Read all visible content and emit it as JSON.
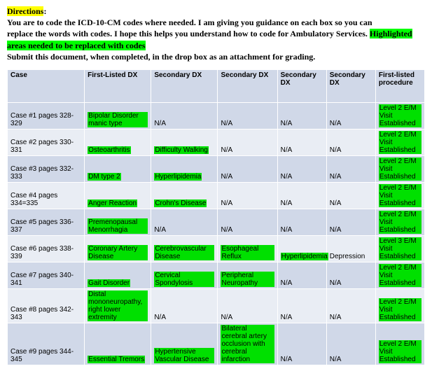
{
  "directions": {
    "label": "Directions",
    "line1a": "You are to code the ICD-10-CM codes where needed.  I am giving you guidance on each box so you can",
    "line2": "replace the words with codes.  I hope this helps you understand how to code for Ambulatory Services.  ",
    "line2_hl": "Highlighted areas needed to be replaced with codes",
    "line3": "Submit this document, when completed, in the drop box as an attachment for grading."
  },
  "headers": {
    "c1": "Case",
    "c2": "First-Listed DX",
    "c3": "Secondary DX",
    "c4": "Secondary DX",
    "c5": "Secondary DX",
    "c6": "Secondary DX",
    "c7": "First-listed procedure"
  },
  "rows": [
    {
      "case": "Case #1 pages 328-329",
      "dx1": {
        "text": "Bipolar Disorder manic type",
        "hl": true
      },
      "dx2": {
        "text": "N/A",
        "hl": false
      },
      "dx3": {
        "text": "N/A",
        "hl": false
      },
      "dx4": {
        "text": "N/A",
        "hl": false
      },
      "dx5": {
        "text": "N/A",
        "hl": false
      },
      "proc": {
        "text": "Level 2 E/M Visit Established",
        "hl": true
      }
    },
    {
      "case": "Case #2 pages 330-331",
      "dx1": {
        "text": "Osteoarthritis",
        "hl": true
      },
      "dx2": {
        "text": "Difficulty Walking",
        "hl": true
      },
      "dx3": {
        "text": "N/A",
        "hl": false
      },
      "dx4": {
        "text": "N/A",
        "hl": false
      },
      "dx5": {
        "text": "N/A",
        "hl": false
      },
      "proc": {
        "text": "Level 2 E/M Visit Established",
        "hl": true
      }
    },
    {
      "case": "Case #3 pages 332-333",
      "dx1": {
        "text": "DM type 2",
        "hl": true
      },
      "dx2": {
        "text": "Hyperlipidemia",
        "hl": true
      },
      "dx3": {
        "text": "N/A",
        "hl": false
      },
      "dx4": {
        "text": "N/A",
        "hl": false
      },
      "dx5": {
        "text": "N/A",
        "hl": false
      },
      "proc": {
        "text": "Level 2 E/M Visit Established",
        "hl": true
      }
    },
    {
      "case": "Case #4 pages 334=335",
      "dx1": {
        "text": "Anger Reaction",
        "hl": true
      },
      "dx2": {
        "text": "Crohn's Disease",
        "hl": true
      },
      "dx3": {
        "text": "N/A",
        "hl": false
      },
      "dx4": {
        "text": "N/A",
        "hl": false
      },
      "dx5": {
        "text": "N/A",
        "hl": false
      },
      "proc": {
        "text": "Level 2 E/M Visit Established",
        "hl": true
      }
    },
    {
      "case": "Case #5 pages 336-337",
      "dx1": {
        "text": "Premenopausal Menorrhagia",
        "hl": true
      },
      "dx2": {
        "text": "N/A",
        "hl": false
      },
      "dx3": {
        "text": "N/A",
        "hl": false
      },
      "dx4": {
        "text": "N/A",
        "hl": false
      },
      "dx5": {
        "text": "N/A",
        "hl": false
      },
      "proc": {
        "text": "Level 2 E/M Visit Established",
        "hl": true
      }
    },
    {
      "case": "Case #6 pages 338-339",
      "dx1": {
        "text": "Coronary Artery Disease",
        "hl": true
      },
      "dx2": {
        "text": "Cerebrovascular Disease",
        "hl": true
      },
      "dx3": {
        "text": "Esophageal Reflux",
        "hl": true
      },
      "dx4": {
        "text": "Hyperlipidemia",
        "hl": true
      },
      "dx5": {
        "text": "Depression",
        "hl": false
      },
      "proc": {
        "text": "Level 3 E/M Visit Established",
        "hl": true
      }
    },
    {
      "case": "Case #7 pages 340-341",
      "dx1": {
        "text": "Gait Disorder",
        "hl": true
      },
      "dx2": {
        "text": "Cervical Spondylosis",
        "hl": true
      },
      "dx3": {
        "text": "Peripheral Neuropathy",
        "hl": true
      },
      "dx4": {
        "text": "N/A",
        "hl": false
      },
      "dx5": {
        "text": "N/A",
        "hl": false
      },
      "proc": {
        "text": "Level 2 E/M Visit Established",
        "hl": true
      }
    },
    {
      "case": "Case #8 pages 342-343",
      "dx1": {
        "text": "Distal mononeuropathy, right lower extremity",
        "hl": true
      },
      "dx2": {
        "text": "N/A",
        "hl": false
      },
      "dx3": {
        "text": "N/A",
        "hl": false
      },
      "dx4": {
        "text": "N/A",
        "hl": false
      },
      "dx5": {
        "text": "N/A",
        "hl": false
      },
      "proc": {
        "text": "Level 2 E/M Visit Established",
        "hl": true
      }
    },
    {
      "case": "Case #9 pages 344-345",
      "dx1": {
        "text": "Essential Tremors",
        "hl": true
      },
      "dx2": {
        "text": "Hypertensive Vascular Disease",
        "hl": true
      },
      "dx3": {
        "text": "Bilateral cerebral artery occlusion with cerebral infarction",
        "hl": true
      },
      "dx4": {
        "text": "N/A",
        "hl": false
      },
      "dx5": {
        "text": "N/A",
        "hl": false
      },
      "proc": {
        "text": "Level 2 E/M Visit Established",
        "hl": true
      }
    }
  ]
}
